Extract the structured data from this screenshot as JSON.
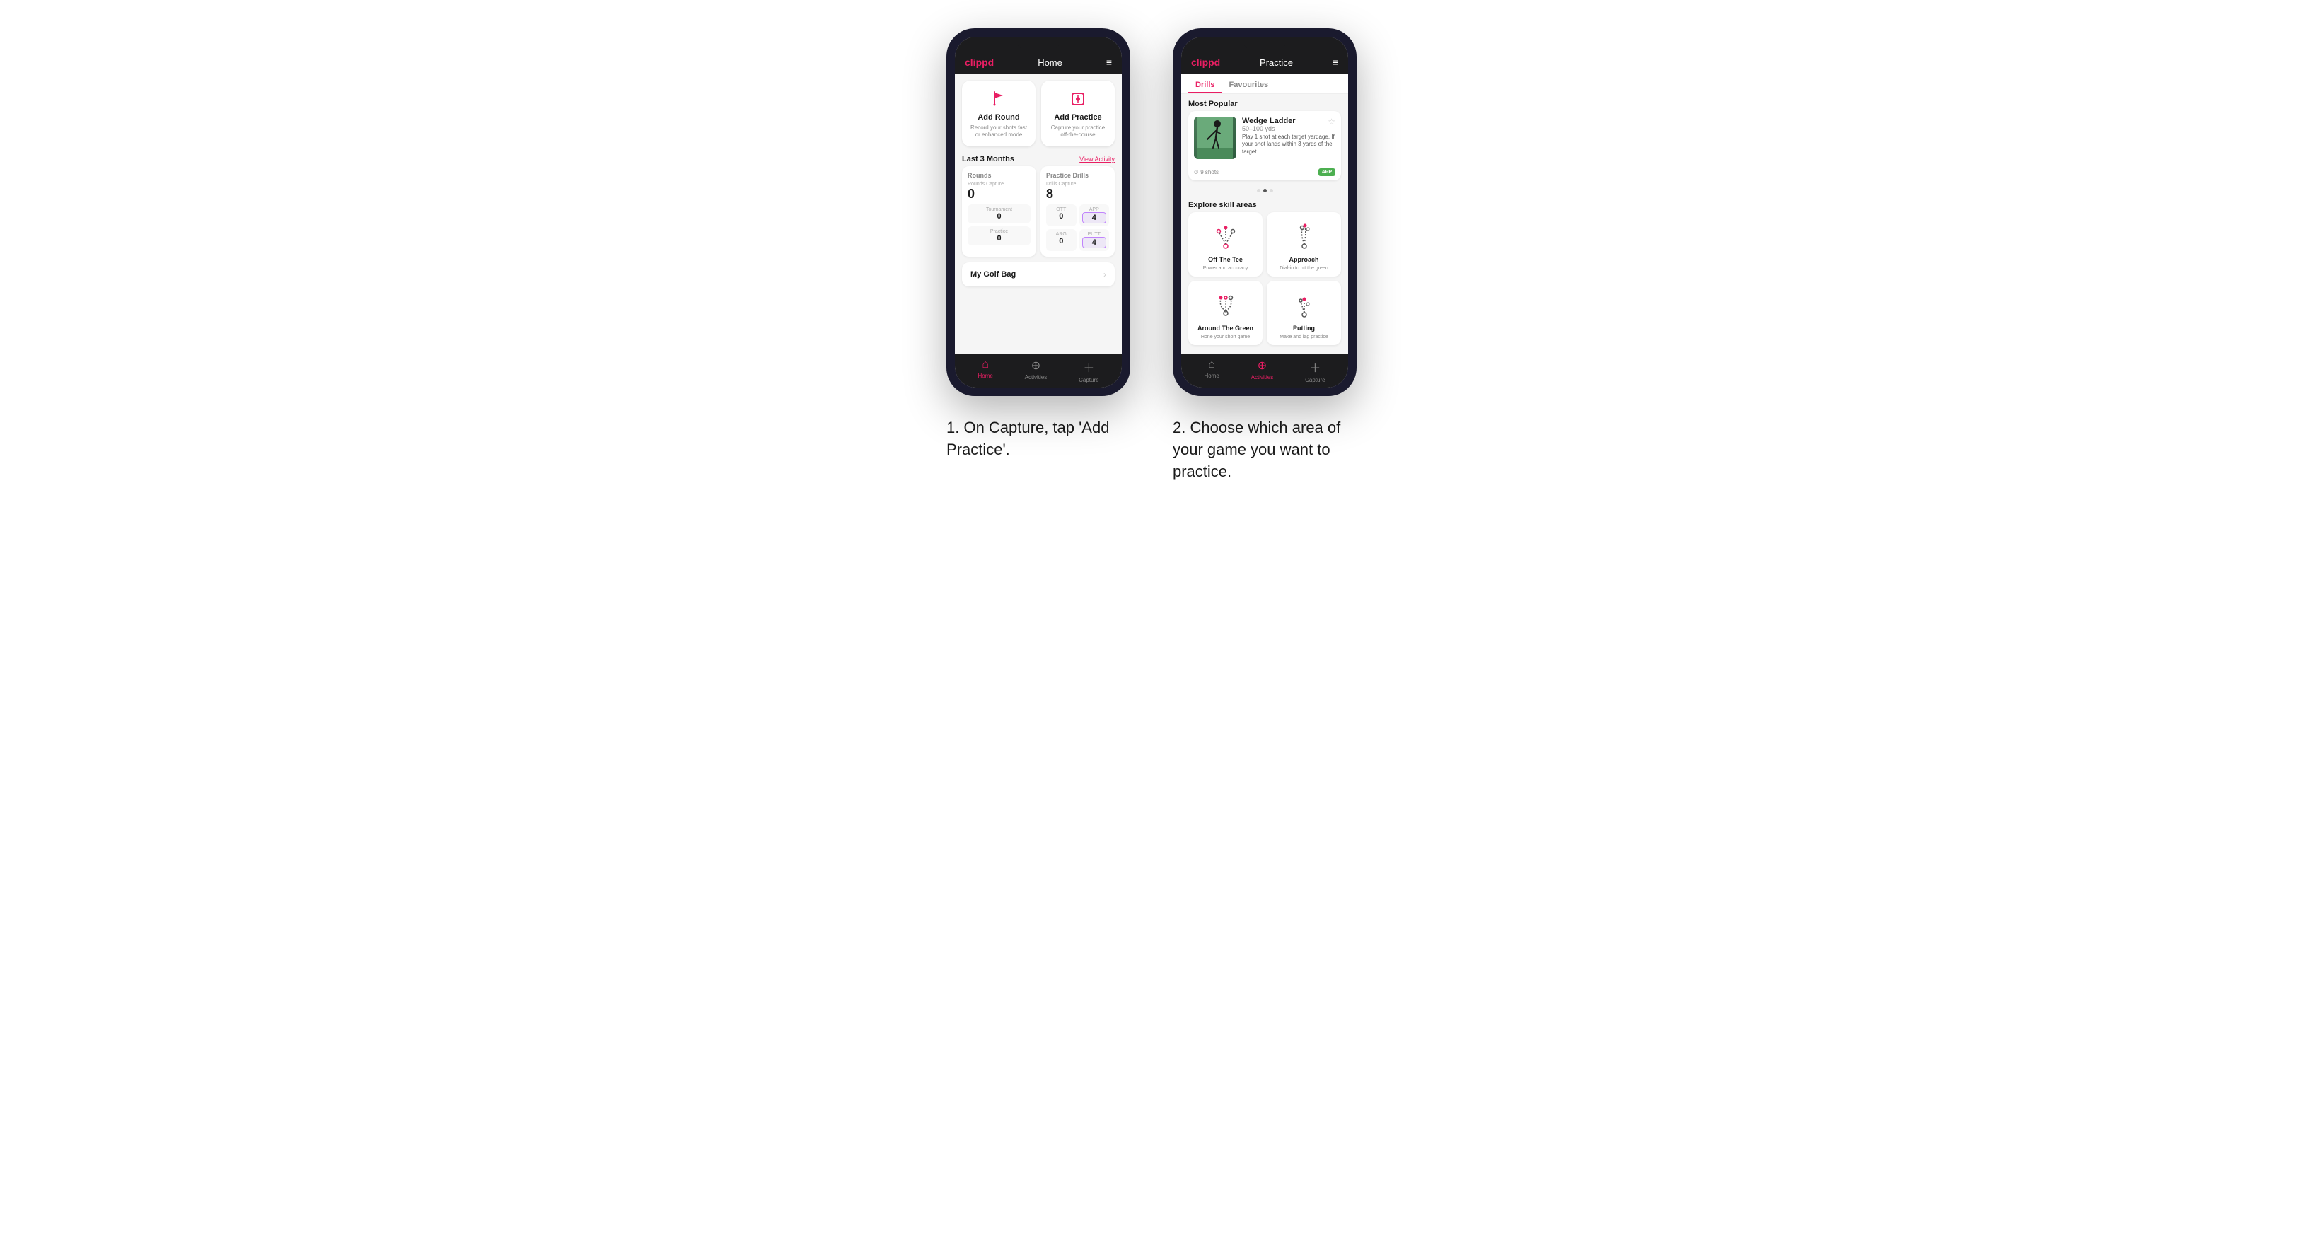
{
  "phone1": {
    "header": {
      "logo": "clippd",
      "title": "Home",
      "menu_icon": "≡"
    },
    "quick_actions": [
      {
        "id": "add_round",
        "title": "Add Round",
        "desc": "Record your shots fast or enhanced mode",
        "icon": "flag"
      },
      {
        "id": "add_practice",
        "title": "Add Practice",
        "desc": "Capture your practice off-the-course",
        "icon": "target"
      }
    ],
    "stats_header": {
      "title": "Last 3 Months",
      "link": "View Activity"
    },
    "rounds": {
      "title": "Rounds",
      "capture_label": "Rounds Capture",
      "capture_value": "0",
      "sub_labels": [
        "Tournament",
        "Practice"
      ],
      "sub_values": [
        "0",
        "0"
      ]
    },
    "practice_drills": {
      "title": "Practice Drills",
      "capture_label": "Drills Capture",
      "capture_value": "8",
      "sub_labels": [
        "OTT",
        "APP",
        "ARG",
        "PUTT"
      ],
      "sub_values": [
        "0",
        "4",
        "0",
        "4"
      ]
    },
    "golf_bag": {
      "title": "My Golf Bag"
    },
    "bottom_nav": [
      {
        "label": "Home",
        "active": true,
        "icon": "⌂"
      },
      {
        "label": "Activities",
        "active": false,
        "icon": "⊕"
      },
      {
        "label": "Capture",
        "active": false,
        "icon": "+"
      }
    ]
  },
  "phone2": {
    "header": {
      "logo": "clippd",
      "title": "Practice",
      "menu_icon": "≡"
    },
    "tabs": [
      {
        "label": "Drills",
        "active": true
      },
      {
        "label": "Favourites",
        "active": false
      }
    ],
    "most_popular": {
      "section_title": "Most Popular",
      "featured": {
        "title": "Wedge Ladder",
        "subtitle": "50–100 yds",
        "desc": "Play 1 shot at each target yardage. If your shot lands within 3 yards of the target..",
        "shots": "9 shots",
        "badge": "APP"
      },
      "dots": [
        false,
        true,
        false
      ]
    },
    "skill_areas": {
      "section_title": "Explore skill areas",
      "items": [
        {
          "id": "off_the_tee",
          "title": "Off The Tee",
          "desc": "Power and accuracy"
        },
        {
          "id": "approach",
          "title": "Approach",
          "desc": "Dial-in to hit the green"
        },
        {
          "id": "around_the_green",
          "title": "Around The Green",
          "desc": "Hone your short game"
        },
        {
          "id": "putting",
          "title": "Putting",
          "desc": "Make and lag practice"
        }
      ]
    },
    "bottom_nav": [
      {
        "label": "Home",
        "active": false,
        "icon": "⌂"
      },
      {
        "label": "Activities",
        "active": true,
        "icon": "⊕"
      },
      {
        "label": "Capture",
        "active": false,
        "icon": "+"
      }
    ]
  },
  "captions": {
    "phone1": "1. On Capture, tap 'Add Practice'.",
    "phone2": "2. Choose which area of your game you want to practice."
  },
  "colors": {
    "brand_pink": "#e91e63",
    "app_green": "#4CAF50",
    "dark_bg": "#1c1c1e",
    "light_bg": "#f5f5f5",
    "white": "#ffffff"
  }
}
